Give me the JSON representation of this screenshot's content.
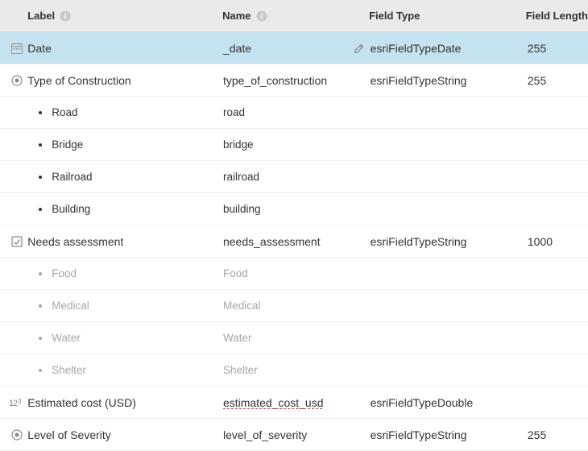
{
  "headers": {
    "label": "Label",
    "name": "Name",
    "field_type": "Field Type",
    "field_length": "Field Length"
  },
  "rows": [
    {
      "icon": "calendar",
      "label": "Date",
      "name": "_date",
      "editable": true,
      "field_type": "esriFieldTypeDate",
      "field_length": "255",
      "selected": true
    },
    {
      "icon": "radio",
      "label": "Type of Construction",
      "name": "type_of_construction",
      "field_type": "esriFieldTypeString",
      "field_length": "255",
      "options": [
        {
          "label": "Road",
          "name": "road"
        },
        {
          "label": "Bridge",
          "name": "bridge"
        },
        {
          "label": "Railroad",
          "name": "railroad"
        },
        {
          "label": "Building",
          "name": "building"
        }
      ]
    },
    {
      "icon": "checkbox",
      "label": "Needs assessment",
      "name": "needs_assessment",
      "field_type": "esriFieldTypeString",
      "field_length": "1000",
      "options_muted": true,
      "options": [
        {
          "label": "Food",
          "name": "Food"
        },
        {
          "label": "Medical",
          "name": "Medical"
        },
        {
          "label": "Water",
          "name": "Water"
        },
        {
          "label": "Shelter",
          "name": "Shelter"
        }
      ]
    },
    {
      "icon": "numeric",
      "label": "Estimated cost (USD)",
      "name": "estimated_cost_usd",
      "name_spelling_error": true,
      "field_type": "esriFieldTypeDouble",
      "field_length": ""
    },
    {
      "icon": "radio",
      "label": "Level of Severity",
      "name": "level_of_severity",
      "field_type": "esriFieldTypeString",
      "field_length": "255"
    }
  ]
}
